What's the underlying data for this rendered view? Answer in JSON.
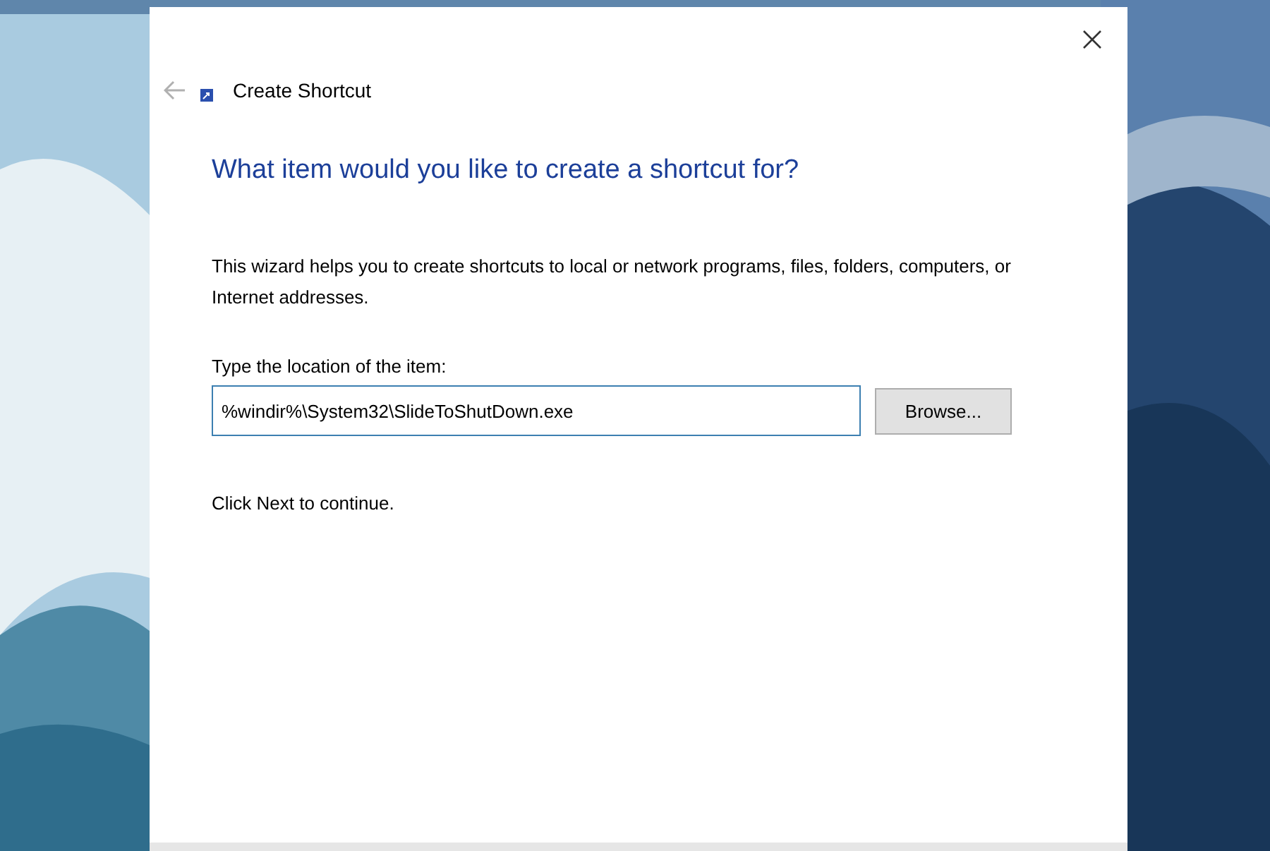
{
  "window": {
    "title": "Create Shortcut"
  },
  "heading": "What item would you like to create a shortcut for?",
  "description": "This wizard helps you to create shortcuts to local or network programs, files, folders, computers, or Internet addresses.",
  "location": {
    "label": "Type the location of the item:",
    "value": "%windir%\\System32\\SlideToShutDown.exe"
  },
  "browse_button": "Browse...",
  "footer_text": "Click Next to continue."
}
